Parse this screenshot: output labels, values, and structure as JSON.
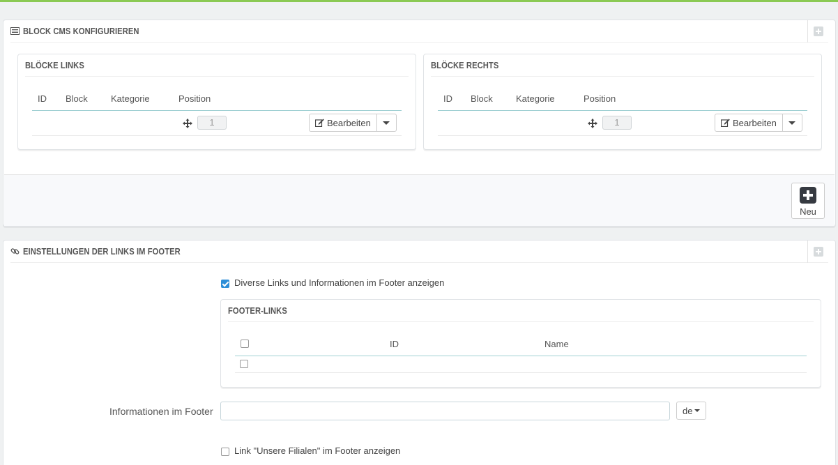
{
  "cms_panel": {
    "title": "BLOCK CMS KONFIGURIEREN",
    "left_block": {
      "title": "BLÖCKE LINKS",
      "columns": [
        "ID",
        "Block",
        "Kategorie",
        "Position"
      ],
      "row": {
        "position": "1",
        "edit_label": "Bearbeiten"
      }
    },
    "right_block": {
      "title": "BLÖCKE RECHTS",
      "columns": [
        "ID",
        "Block",
        "Kategorie",
        "Position"
      ],
      "row": {
        "position": "1",
        "edit_label": "Bearbeiten"
      }
    },
    "new_button_label": "Neu"
  },
  "footer_panel": {
    "title": "EINSTELLUNGEN DER LINKS IM FOOTER",
    "show_links_label": "Diverse Links und Informationen im Footer anzeigen",
    "show_links_checked": true,
    "footer_links": {
      "title": "FOOTER-LINKS",
      "columns": [
        "ID",
        "Name"
      ]
    },
    "info_label": "Informationen im Footer",
    "info_value": "",
    "lang": "de",
    "stores_link_label": "Link \"Unsere Filialen\" im Footer anzeigen",
    "stores_link_checked": false
  },
  "colors": {
    "accent": "#8bc954",
    "checkbox": "#2e8fd8",
    "table_rule": "#a0d0d3"
  }
}
